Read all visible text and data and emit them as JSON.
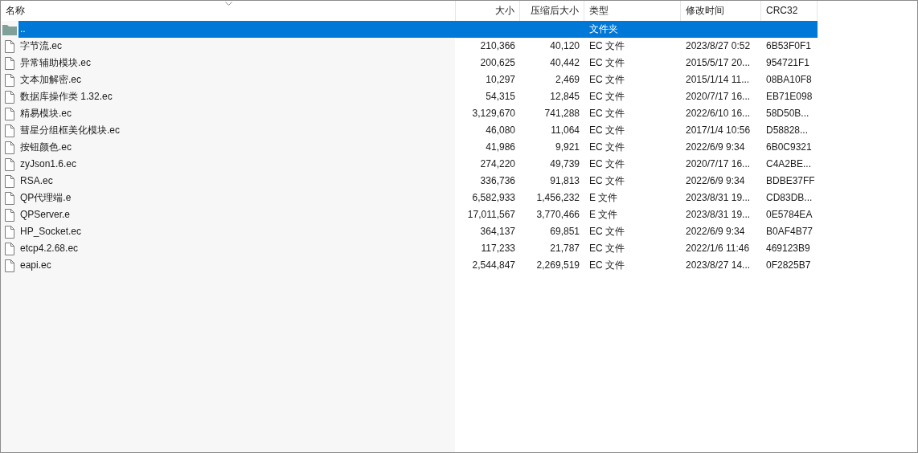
{
  "table": {
    "columns": [
      {
        "label": "名称",
        "sorted": true
      },
      {
        "label": "大小",
        "sorted": false
      },
      {
        "label": "压缩后大小",
        "sorted": false
      },
      {
        "label": "类型",
        "sorted": false
      },
      {
        "label": "修改时间",
        "sorted": false
      },
      {
        "label": "CRC32",
        "sorted": false
      }
    ],
    "rows": [
      {
        "kind": "folder",
        "selected": true,
        "name": "..",
        "type": "文件夹"
      },
      {
        "kind": "file",
        "selected": false,
        "name": "字节流.ec",
        "size": "210,366",
        "packed": "40,120",
        "type": "EC 文件",
        "modified": "2023/8/27 0:52",
        "crc": "6B53F0F1"
      },
      {
        "kind": "file",
        "selected": false,
        "name": "异常辅助模块.ec",
        "size": "200,625",
        "packed": "40,442",
        "type": "EC 文件",
        "modified": "2015/5/17 20...",
        "crc": "954721F1"
      },
      {
        "kind": "file",
        "selected": false,
        "name": "文本加解密.ec",
        "size": "10,297",
        "packed": "2,469",
        "type": "EC 文件",
        "modified": "2015/1/14 11...",
        "crc": "08BA10F8"
      },
      {
        "kind": "file",
        "selected": false,
        "name": "数据库操作类 1.32.ec",
        "size": "54,315",
        "packed": "12,845",
        "type": "EC 文件",
        "modified": "2020/7/17 16...",
        "crc": "EB71E098"
      },
      {
        "kind": "file",
        "selected": false,
        "name": "精易模块.ec",
        "size": "3,129,670",
        "packed": "741,288",
        "type": "EC 文件",
        "modified": "2022/6/10 16...",
        "crc": "58D50B..."
      },
      {
        "kind": "file",
        "selected": false,
        "name": "彗星分组框美化模块.ec",
        "size": "46,080",
        "packed": "11,064",
        "type": "EC 文件",
        "modified": "2017/1/4 10:56",
        "crc": "D58828..."
      },
      {
        "kind": "file",
        "selected": false,
        "name": "按钮颜色.ec",
        "size": "41,986",
        "packed": "9,921",
        "type": "EC 文件",
        "modified": "2022/6/9 9:34",
        "crc": "6B0C9321"
      },
      {
        "kind": "file",
        "selected": false,
        "name": "zyJson1.6.ec",
        "size": "274,220",
        "packed": "49,739",
        "type": "EC 文件",
        "modified": "2020/7/17 16...",
        "crc": "C4A2BE..."
      },
      {
        "kind": "file",
        "selected": false,
        "name": "RSA.ec",
        "size": "336,736",
        "packed": "91,813",
        "type": "EC 文件",
        "modified": "2022/6/9 9:34",
        "crc": "BDBE37FF"
      },
      {
        "kind": "file",
        "selected": false,
        "name": "QP代理端.e",
        "size": "6,582,933",
        "packed": "1,456,232",
        "type": "E 文件",
        "modified": "2023/8/31 19...",
        "crc": "CD83DB..."
      },
      {
        "kind": "file",
        "selected": false,
        "name": "QPServer.e",
        "size": "17,011,567",
        "packed": "3,770,466",
        "type": "E 文件",
        "modified": "2023/8/31 19...",
        "crc": "0E5784EA"
      },
      {
        "kind": "file",
        "selected": false,
        "name": "HP_Socket.ec",
        "size": "364,137",
        "packed": "69,851",
        "type": "EC 文件",
        "modified": "2022/6/9 9:34",
        "crc": "B0AF4B77"
      },
      {
        "kind": "file",
        "selected": false,
        "name": "etcp4.2.68.ec",
        "size": "117,233",
        "packed": "21,787",
        "type": "EC 文件",
        "modified": "2022/1/6 11:46",
        "crc": "469123B9"
      },
      {
        "kind": "file",
        "selected": false,
        "name": "eapi.ec",
        "size": "2,544,847",
        "packed": "2,269,519",
        "type": "EC 文件",
        "modified": "2023/8/27 14...",
        "crc": "0F2825B7"
      }
    ]
  }
}
